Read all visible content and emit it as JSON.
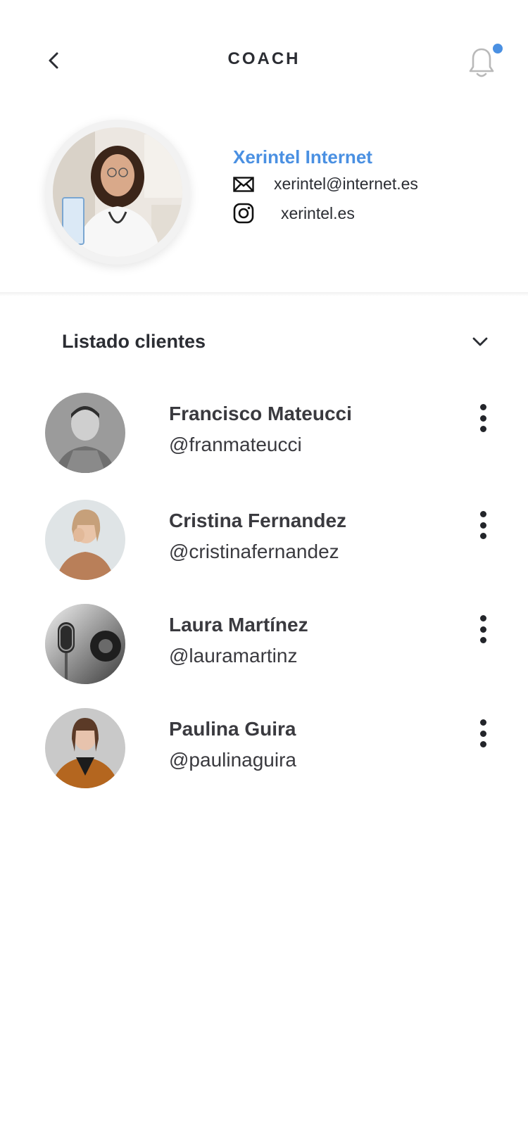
{
  "header": {
    "title": "COACH",
    "back_icon": "chevron-left-icon",
    "notification_icon": "bell-icon",
    "notification_dot_color": "#4a90e2"
  },
  "coach": {
    "name": "Xerintel Internet",
    "name_color": "#4a90e2",
    "email": "xerintel@internet.es",
    "instagram": "xerintel.es"
  },
  "clients_section": {
    "title": "Listado clientes",
    "toggle_icon": "chevron-down-icon"
  },
  "clients": [
    {
      "name": "Francisco Mateucci",
      "handle": "@franmateucci"
    },
    {
      "name": "Cristina Fernandez",
      "handle": "@cristinafernandez"
    },
    {
      "name": "Laura Martínez",
      "handle": "@lauramartinz"
    },
    {
      "name": "Paulina Guira",
      "handle": "@paulinaguira"
    }
  ]
}
